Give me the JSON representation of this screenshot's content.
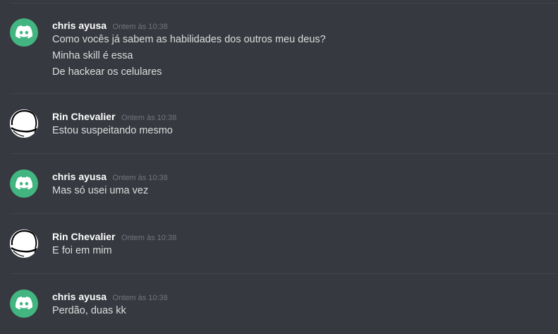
{
  "messages": [
    {
      "author": "chris ayusa",
      "timestamp": "Ontem às 10:38",
      "avatar": "discord-logo-icon",
      "avatar_color": "#43b581",
      "lines": [
        "Como vocês já sabem as habilidades dos outros meu deus?",
        "Minha skill é essa",
        "De hackear os celulares"
      ]
    },
    {
      "author": "Rin Chevalier",
      "timestamp": "Ontem às 10:38",
      "avatar": "sketch-avatar-icon",
      "lines": [
        "Estou suspeitando mesmo"
      ]
    },
    {
      "author": "chris ayusa",
      "timestamp": "Ontem às 10:38",
      "avatar": "discord-logo-icon",
      "avatar_color": "#43b581",
      "lines": [
        "Mas só usei uma vez"
      ]
    },
    {
      "author": "Rin Chevalier",
      "timestamp": "Ontem às 10:38",
      "avatar": "sketch-avatar-icon",
      "lines": [
        "E foi em mim"
      ]
    },
    {
      "author": "chris ayusa",
      "timestamp": "Ontem às 10:38",
      "avatar": "discord-logo-icon",
      "avatar_color": "#43b581",
      "lines": [
        "Perdão, duas kk"
      ]
    }
  ],
  "colors": {
    "background": "#36393f",
    "username": "#ffffff",
    "timestamp": "#72767d",
    "message_text": "#dcddde",
    "divider": "#42454a"
  }
}
